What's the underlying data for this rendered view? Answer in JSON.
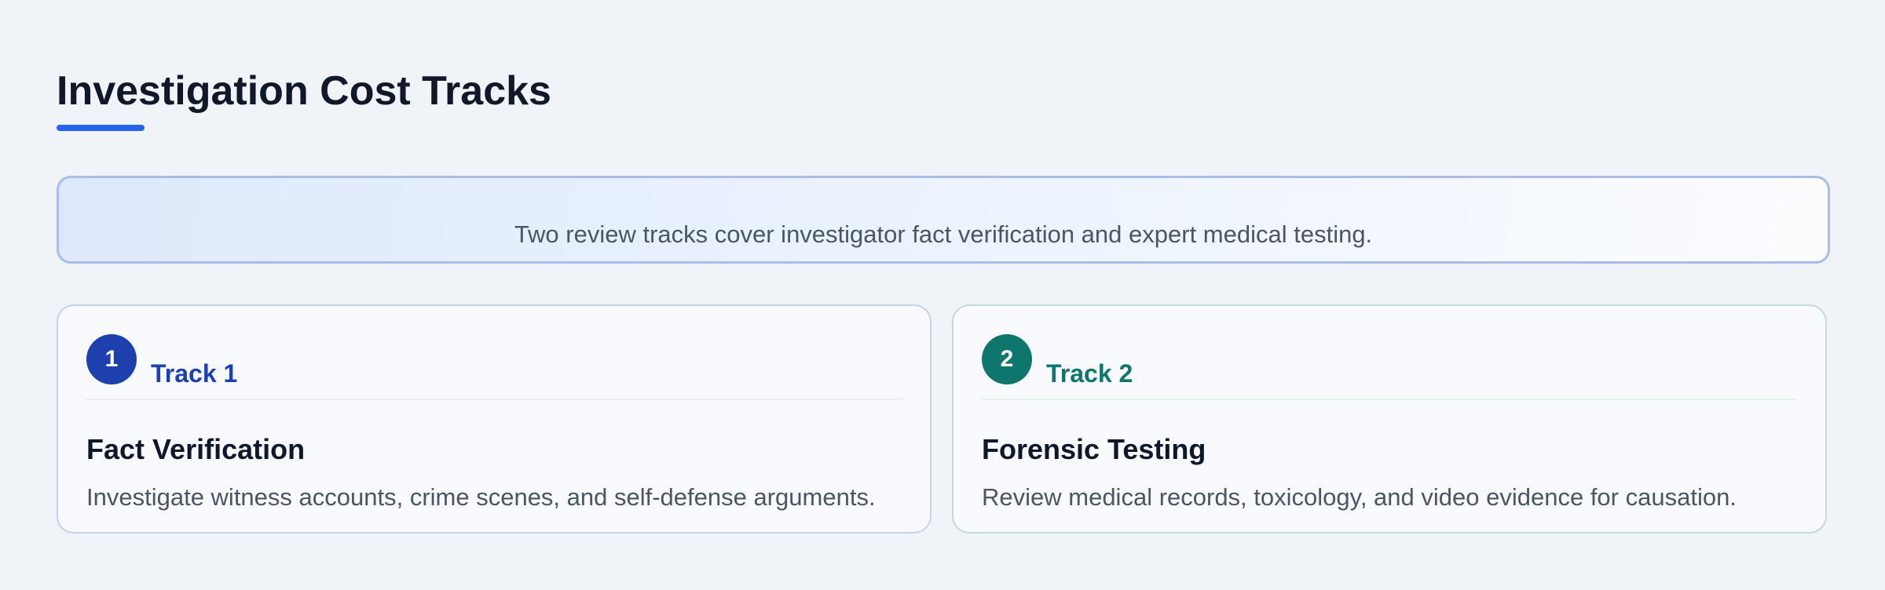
{
  "page": {
    "title": "Investigation Cost Tracks"
  },
  "banner": {
    "text": "Two review tracks cover investigator fact verification and expert medical testing."
  },
  "tracks": [
    {
      "number": "1",
      "label": "Track 1",
      "title": "Fact Verification",
      "description": "Investigate witness accounts, crime scenes, and self-defense arguments.",
      "color": "#1e40af"
    },
    {
      "number": "2",
      "label": "Track 2",
      "title": "Forensic Testing",
      "description": "Review medical records, toxicology, and video evidence for causation.",
      "color": "#0f766e"
    }
  ],
  "colors": {
    "accent": "#2563eb",
    "background": "#f0f3f8"
  }
}
